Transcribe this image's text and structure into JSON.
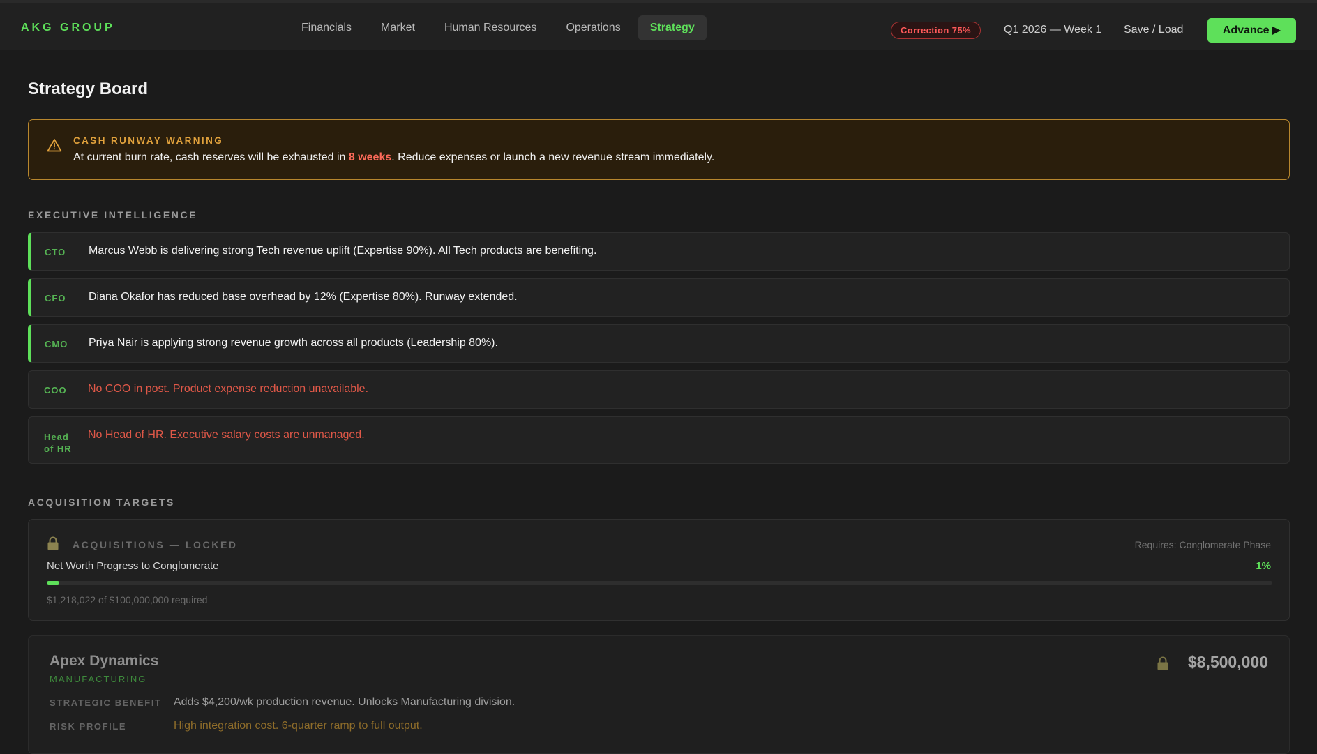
{
  "app": {
    "brand": "AKG GROUP"
  },
  "nav": {
    "items": [
      {
        "label": "Financials"
      },
      {
        "label": "Market"
      },
      {
        "label": "Human Resources"
      },
      {
        "label": "Operations"
      },
      {
        "label": "Strategy"
      }
    ],
    "active": "Strategy"
  },
  "header": {
    "correction_badge": "Correction 75%",
    "period": "Q1 2026 — Week 1",
    "save_load": "Save / Load",
    "advance": "Advance ▶"
  },
  "page": {
    "title": "Strategy Board"
  },
  "warning": {
    "title": "CASH RUNWAY WARNING",
    "text_before": "At current burn rate, cash reserves will be exhausted in ",
    "highlight": "8 weeks",
    "text_after": ". Reduce expenses or launch a new revenue stream immediately.",
    "icon": "warning-triangle-icon",
    "accent": "#e0a13c"
  },
  "executive_intelligence": {
    "title": "EXECUTIVE INTELLIGENCE",
    "items": [
      {
        "role": "CTO",
        "status": "ok",
        "message": "Marcus Webb is delivering strong Tech revenue uplift (Expertise 90%). All Tech products are benefiting."
      },
      {
        "role": "CFO",
        "status": "ok",
        "message": "Diana Okafor has reduced base overhead by 12% (Expertise 80%). Runway extended."
      },
      {
        "role": "CMO",
        "status": "ok",
        "message": "Priya Nair is applying strong revenue growth across all products (Leadership 80%)."
      },
      {
        "role": "COO",
        "status": "vacant",
        "message": "No COO in post. Product expense reduction unavailable."
      },
      {
        "role_line1": "Head",
        "role_line2": "of HR",
        "status": "vacant",
        "message": "No Head of HR. Executive salary costs are unmanaged."
      }
    ]
  },
  "acquisitions": {
    "title": "ACQUISITION TARGETS",
    "locked": {
      "title": "ACQUISITIONS — LOCKED",
      "requirement": "Requires: Conglomerate Phase",
      "progress_label": "Net Worth Progress to Conglomerate",
      "progress_pct": "1%",
      "progress_fraction": 0.01,
      "detail": "$1,218,022 of $100,000,000 required",
      "icon": "lock-icon"
    },
    "targets": [
      {
        "name": "Apex Dynamics",
        "sector": "MANUFACTURING",
        "price": "$8,500,000",
        "benefit_label": "STRATEGIC BENEFIT",
        "benefit": "Adds $4,200/wk production revenue. Unlocks Manufacturing division.",
        "risk_label": "RISK PROFILE",
        "risk": "High integration cost. 6-quarter ramp to full output."
      }
    ]
  },
  "colors": {
    "accent_green": "#5ee05a",
    "danger_red": "#e05848",
    "warning_amber": "#e0a13c",
    "background": "#1b1b1b"
  }
}
